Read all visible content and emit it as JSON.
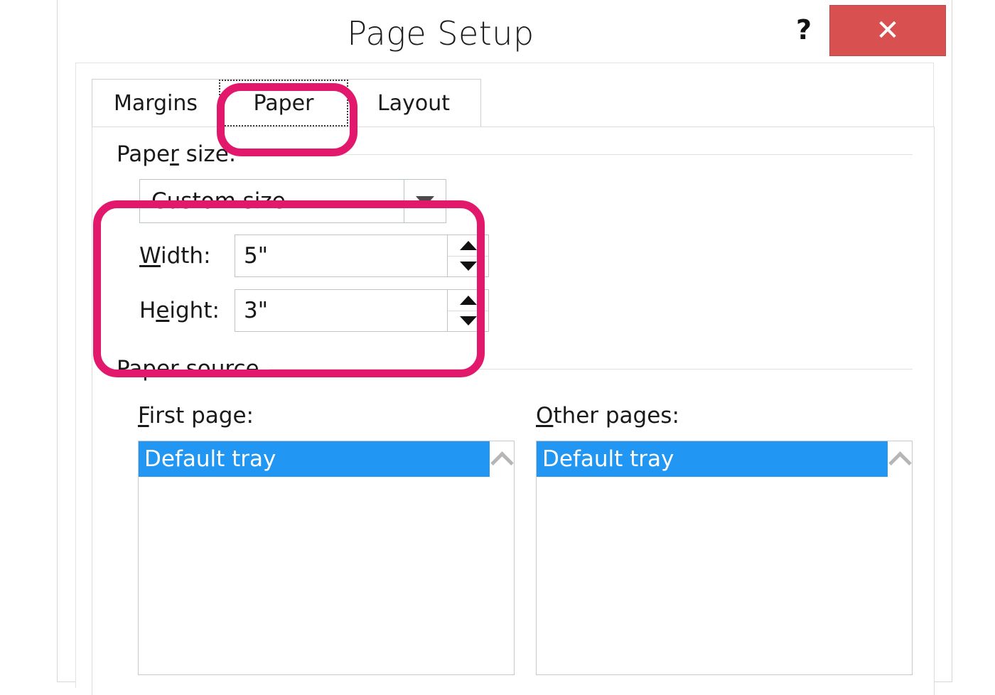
{
  "dialog": {
    "title": "Page Setup",
    "help_icon": "question-mark-icon",
    "close_icon": "close-x-icon",
    "close_color": "#d8504f"
  },
  "tabs": [
    {
      "label": "Margins",
      "selected": false
    },
    {
      "label": "Paper",
      "selected": true
    },
    {
      "label": "Layout",
      "selected": false
    }
  ],
  "paper_size": {
    "group_label_pre": "Pape",
    "group_label_key": "r",
    "group_label_post": " size:",
    "combo": {
      "value": "Custom size",
      "arrow_icon": "chevron-down-icon"
    },
    "width": {
      "label_key": "W",
      "label_post": "idth:",
      "value": "5\"",
      "up_icon": "triangle-up-icon",
      "down_icon": "triangle-down-icon"
    },
    "height": {
      "label_pre": "H",
      "label_key": "e",
      "label_post": "ight:",
      "value": "3\"",
      "up_icon": "triangle-up-icon",
      "down_icon": "triangle-down-icon"
    }
  },
  "paper_source": {
    "group_label": "Paper source",
    "first_page": {
      "label_key": "F",
      "label_post": "irst page:",
      "items": [
        "Default tray"
      ],
      "selected_index": 0,
      "scroll_up_icon": "chevron-up-icon"
    },
    "other_pages": {
      "label_key": "O",
      "label_post": "ther pages:",
      "items": [
        "Default tray"
      ],
      "selected_index": 0,
      "scroll_up_icon": "chevron-up-icon"
    }
  },
  "annotations": {
    "color": "#e2186c",
    "highlights": [
      "paper-tab",
      "paper-size-controls"
    ]
  },
  "colors": {
    "selection_blue": "#2196f3",
    "close_red": "#d8504f",
    "annotation_pink": "#e2186c"
  }
}
